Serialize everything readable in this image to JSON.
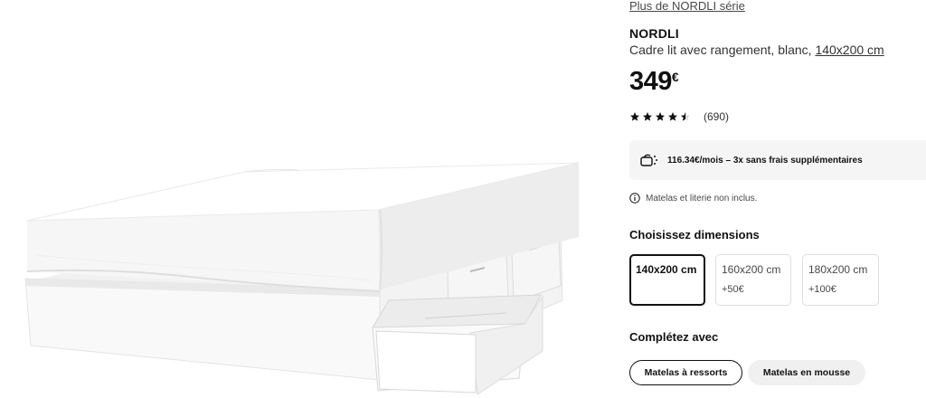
{
  "product": {
    "series_link": "Plus de NORDLI série",
    "name": "NORDLI",
    "description_text": "Cadre lit avec rangement, blanc,",
    "description_size": "140x200 cm",
    "price": "349",
    "currency": "€",
    "rating": {
      "stars": 4.5,
      "max": 5,
      "review_count": "(690)"
    }
  },
  "installment": {
    "icon": "payment-icon",
    "text": "116.34€/mois – 3x sans frais supplémentaires"
  },
  "notice": {
    "icon": "info-icon",
    "text": "Matelas et literie non inclus."
  },
  "dimensions": {
    "title": "Choisissez dimensions",
    "options": [
      {
        "label": "140x200 cm",
        "extra": "",
        "selected": true
      },
      {
        "label": "160x200 cm",
        "extra": "+50€",
        "selected": false
      },
      {
        "label": "180x200 cm",
        "extra": "+100€",
        "selected": false
      }
    ]
  },
  "complete": {
    "title": "Complétez avec",
    "buttons": [
      {
        "label": "Matelas à ressorts",
        "selected": true
      },
      {
        "label": "Matelas en mousse",
        "selected": false
      }
    ]
  },
  "colors": {
    "text": "#111111",
    "muted": "#484848",
    "panel_bg": "#f5f5f5",
    "border": "#dfdfdf"
  }
}
